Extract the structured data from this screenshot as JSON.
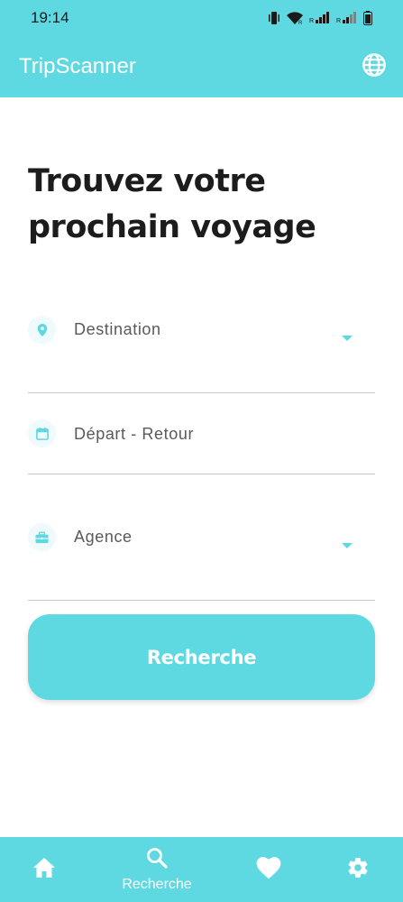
{
  "status_bar": {
    "time": "19:14",
    "icons": [
      "vibrate-icon",
      "wifi-icon",
      "signal-icon",
      "signal-roaming-icon",
      "battery-icon"
    ]
  },
  "app_bar": {
    "title": "TripScanner",
    "language_icon": "globe-icon"
  },
  "main": {
    "headline": "Trouvez votre prochain voyage",
    "fields": {
      "destination": {
        "label": "Destination",
        "icon": "location-pin-icon"
      },
      "dates": {
        "label": "Départ - Retour",
        "icon": "calendar-icon"
      },
      "agency": {
        "label": "Agence",
        "icon": "briefcase-icon"
      }
    },
    "search_button_label": "Recherche"
  },
  "bottom_nav": {
    "items": [
      {
        "id": "home",
        "icon": "home-icon",
        "label": ""
      },
      {
        "id": "search",
        "icon": "search-icon",
        "label": "Recherche",
        "active": true
      },
      {
        "id": "favorites",
        "icon": "heart-icon",
        "label": ""
      },
      {
        "id": "settings",
        "icon": "gear-icon",
        "label": ""
      }
    ]
  },
  "colors": {
    "accent": "#5fd9e1",
    "icon_bg": "#eefafb",
    "text_dark": "#1c1c1c",
    "text_muted": "#5a5a5a",
    "divider": "#c9c9c9"
  }
}
